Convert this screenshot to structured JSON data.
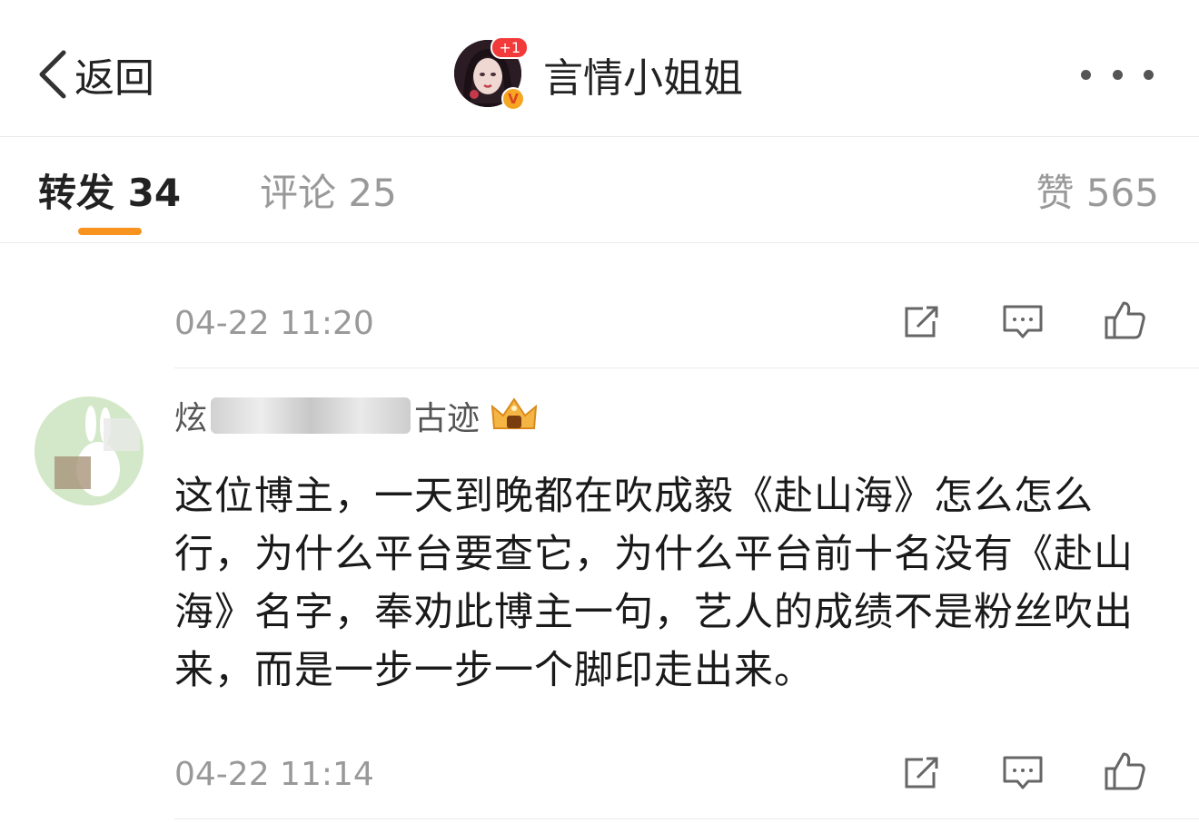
{
  "header": {
    "back_label": "返回",
    "title": "言情小姐姐",
    "avatar_badge": "+1",
    "verified_badge": "V"
  },
  "tabs": [
    {
      "label": "转发 34"
    },
    {
      "label": "评论 25"
    },
    {
      "label": "赞 565"
    }
  ],
  "accent_color": "#f7931e",
  "items": [
    {
      "time": "04-22 11:20"
    },
    {
      "user_name_start": "炫",
      "user_name_end": "古迹",
      "user_badge": "crown-icon",
      "text": "这位博主，一天到晚都在吹成毅《赴山海》怎么怎么行，为什么平台要查它，为什么平台前十名没有《赴山海》名字，奉劝此博主一句，艺人的成绩不是粉丝吹出来，而是一步一步一个脚印走出来。",
      "time": "04-22 11:14"
    }
  ]
}
